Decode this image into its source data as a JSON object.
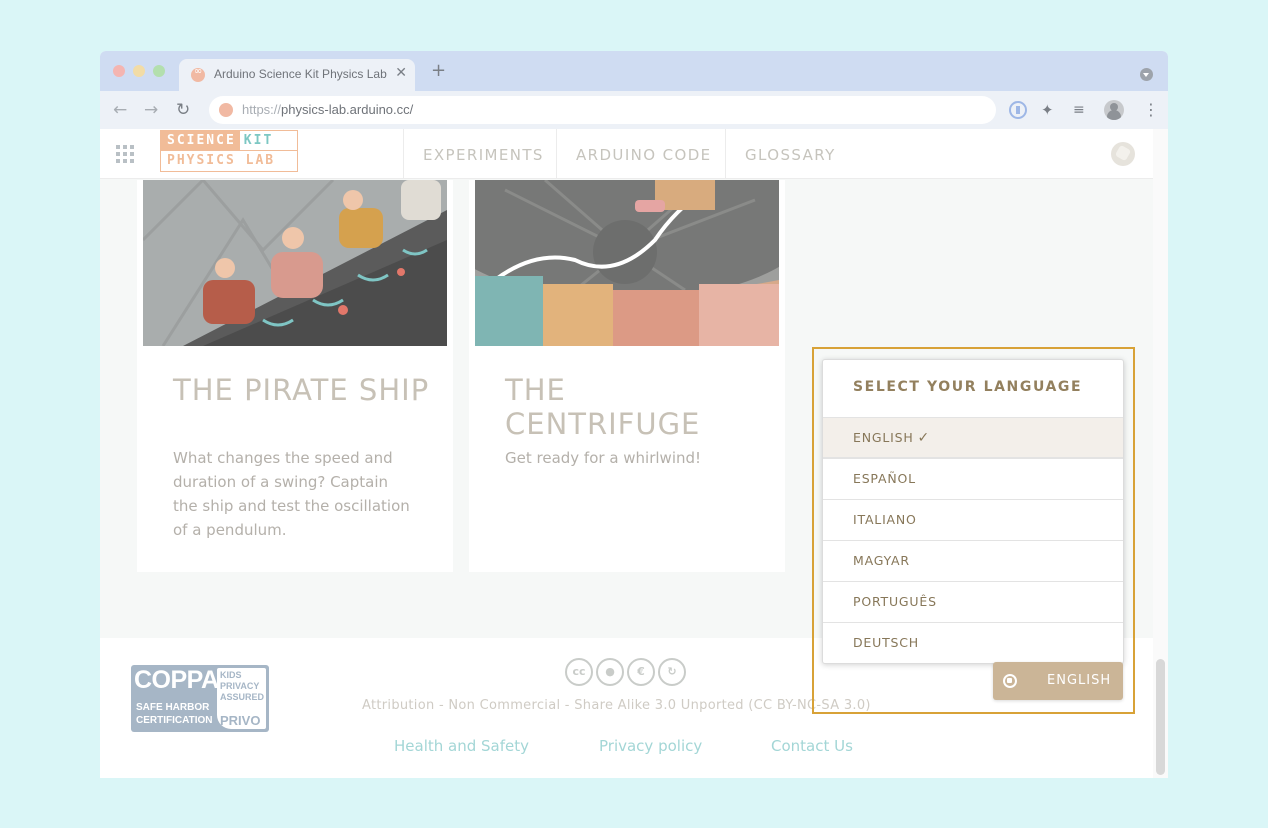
{
  "browser": {
    "tab_title": "Arduino Science Kit Physics Lab",
    "new_tab_icon": "plus-icon",
    "close_tab_glyph": "✕",
    "url_scheme": "https://",
    "url_host": "physics-lab.arduino.cc/",
    "extensions": [
      "1password-icon",
      "puzzle-icon",
      "media-queue-icon"
    ],
    "colors": {
      "tabstrip": "#cfdcf2",
      "toolbar": "#edf1f7"
    }
  },
  "site": {
    "logo": {
      "line1_a": "SCIENCE",
      "line1_b": "KIT",
      "line2": "PHYSICS LAB"
    },
    "nav": [
      {
        "label": "EXPERIMENTS"
      },
      {
        "label": "ARDUINO CODE"
      },
      {
        "label": "GLOSSARY"
      }
    ],
    "colors": {
      "logo_orange": "#f1bc98",
      "logo_teal": "#7cc7c3"
    }
  },
  "cards": [
    {
      "title": "THE PIRATE SHIP",
      "description": "What changes the speed and duration of a swing? Captain the ship and test the oscillation of a pendulum."
    },
    {
      "title": "THE CENTRIFUGE",
      "description": "Get ready for a whirlwind!"
    }
  ],
  "language_selector": {
    "title": "SELECT YOUR LANGUAGE",
    "options": [
      {
        "label": "ENGLISH",
        "selected": true
      },
      {
        "label": "ESPAÑOL",
        "selected": false
      },
      {
        "label": "ITALIANO",
        "selected": false
      },
      {
        "label": "MAGYAR",
        "selected": false
      },
      {
        "label": "PORTUGUÊS",
        "selected": false
      },
      {
        "label": "DEUTSCH",
        "selected": false
      }
    ],
    "check_glyph": "✓",
    "button_label": "ENGLISH",
    "colors": {
      "highlight_outline": "#d8a237",
      "button": "#cbb597"
    }
  },
  "footer": {
    "coppa": {
      "main": "COPPA",
      "sub_line1": "SAFE HARBOR",
      "sub_line2": "CERTIFICATION",
      "badge_line1": "KIDS",
      "badge_line2": "PRIVACY",
      "badge_line3": "ASSURED",
      "badge_privo": "PRIVO"
    },
    "cc_icons": [
      "cc-icon",
      "by-icon",
      "nc-icon",
      "sa-icon"
    ],
    "license": "Attribution - Non Commercial - Share Alike 3.0 Unported (CC BY-NC-SA 3.0)",
    "links": [
      {
        "label": "Health and Safety"
      },
      {
        "label": "Privacy policy"
      },
      {
        "label": "Contact Us"
      }
    ]
  }
}
